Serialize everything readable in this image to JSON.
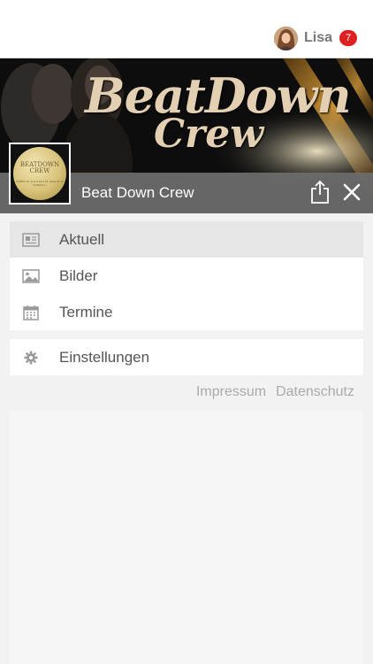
{
  "header": {
    "user_name": "Lisa",
    "notification_count": "7",
    "avatar": "user-avatar-photo"
  },
  "banner": {
    "logo_line1": "BeatDown",
    "logo_line2": "Crew",
    "thumb_line1": "BEATDOWN CREW",
    "thumb_line2": "ROBIN W. & JULIAN M. ANJA R. & TOBIAS L."
  },
  "group": {
    "title": "Beat Down Crew",
    "share_icon": "share-icon",
    "close_icon": "close-icon"
  },
  "menu": {
    "items": [
      {
        "label": "Aktuell",
        "icon": "newspaper-icon",
        "active": true
      },
      {
        "label": "Bilder",
        "icon": "image-icon",
        "active": false
      },
      {
        "label": "Termine",
        "icon": "calendar-icon",
        "active": false
      }
    ],
    "settings": {
      "label": "Einstellungen",
      "icon": "gear-icon"
    }
  },
  "footer": {
    "impressum": "Impressum",
    "datenschutz": "Datenschutz"
  },
  "colors": {
    "badge": "#e02020",
    "titlebar": "#6e6e6e",
    "active_row": "#e6e6e6"
  }
}
